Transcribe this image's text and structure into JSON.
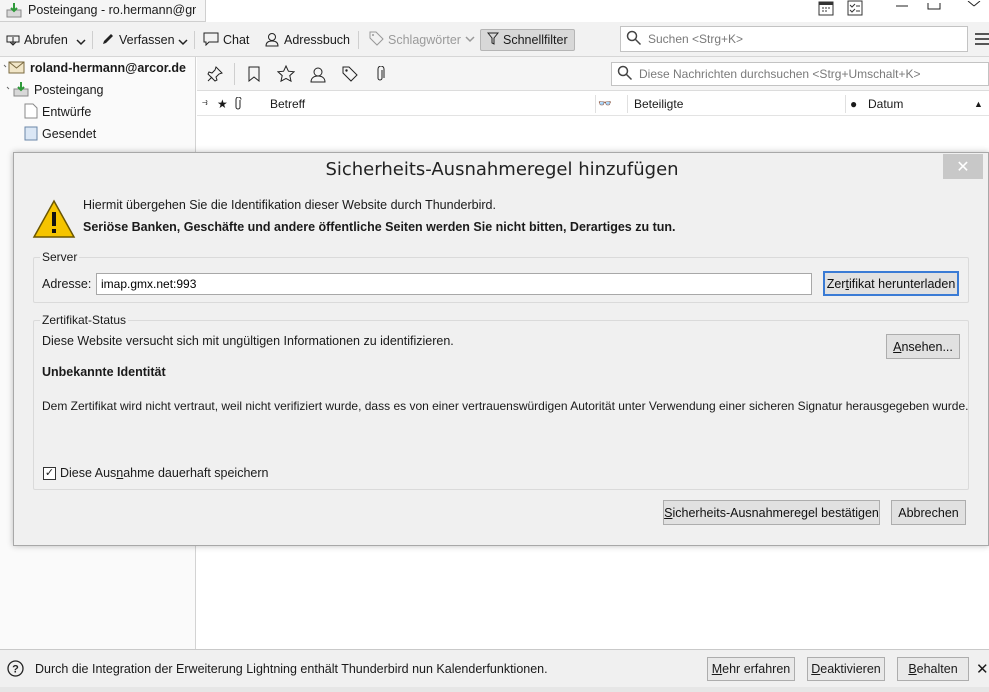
{
  "tab": {
    "title": "Posteingang - ro.hermann@gm"
  },
  "toolbar": {
    "abrufen": "Abrufen",
    "verfassen": "Verfassen",
    "chat": "Chat",
    "adressbuch": "Adressbuch",
    "schlagwoerter": "Schlagwörter",
    "schnellfilter": "Schnellfilter",
    "search_placeholder": "Suchen <Strg+K>"
  },
  "folders": {
    "account": "roland-hermann@arcor.de",
    "items": [
      "Posteingang",
      "Entwürfe",
      "Gesendet"
    ]
  },
  "quickfilter": {
    "search_placeholder": "Diese Nachrichten durchsuchen <Strg+Umschalt+K>"
  },
  "columns": {
    "betreff": "Betreff",
    "beteiligte": "Beteiligte",
    "datum": "Datum"
  },
  "dialog": {
    "title": "Sicherheits-Ausnahmeregel hinzufügen",
    "warning_line1": "Hiermit übergehen Sie die Identifikation dieser Website durch Thunderbird.",
    "warning_line2": "Seriöse Banken, Geschäfte und andere öffentliche Seiten werden Sie nicht bitten, Derartiges zu tun.",
    "server_group": "Server",
    "address_label": "Adresse:",
    "address_value": "imap.gmx.net:993",
    "download_cert_pre": "Zer",
    "download_cert_u": "t",
    "download_cert_post": "ifikat herunterladen",
    "status_group": "Zertifikat-Status",
    "status_text": "Diese Website versucht sich mit ungültigen Informationen zu identifizieren.",
    "view_pre": "",
    "view_u": "A",
    "view_post": "nsehen...",
    "identity_title": "Unbekannte Identität",
    "identity_text": "Dem Zertifikat wird nicht vertraut, weil nicht verifiziert wurde, dass es von einer vertrauenswürdigen Autorität unter Verwendung einer sicheren Signatur herausgegeben wurde.",
    "permanent_pre": "Diese Aus",
    "permanent_u": "n",
    "permanent_post": "ahme dauerhaft speichern",
    "permanent_checked": true,
    "confirm_pre": "",
    "confirm_u": "S",
    "confirm_post": "icherheits-Ausnahmeregel bestätigen",
    "cancel": "Abbrechen"
  },
  "notification": {
    "text": "Durch die Integration der Erweiterung Lightning enthält Thunderbird nun Kalenderfunktionen.",
    "more_u": "M",
    "more_post": "ehr erfahren",
    "deactivate_u": "D",
    "deactivate_post": "eaktivieren",
    "keep_u": "B",
    "keep_post": "ehalten"
  }
}
